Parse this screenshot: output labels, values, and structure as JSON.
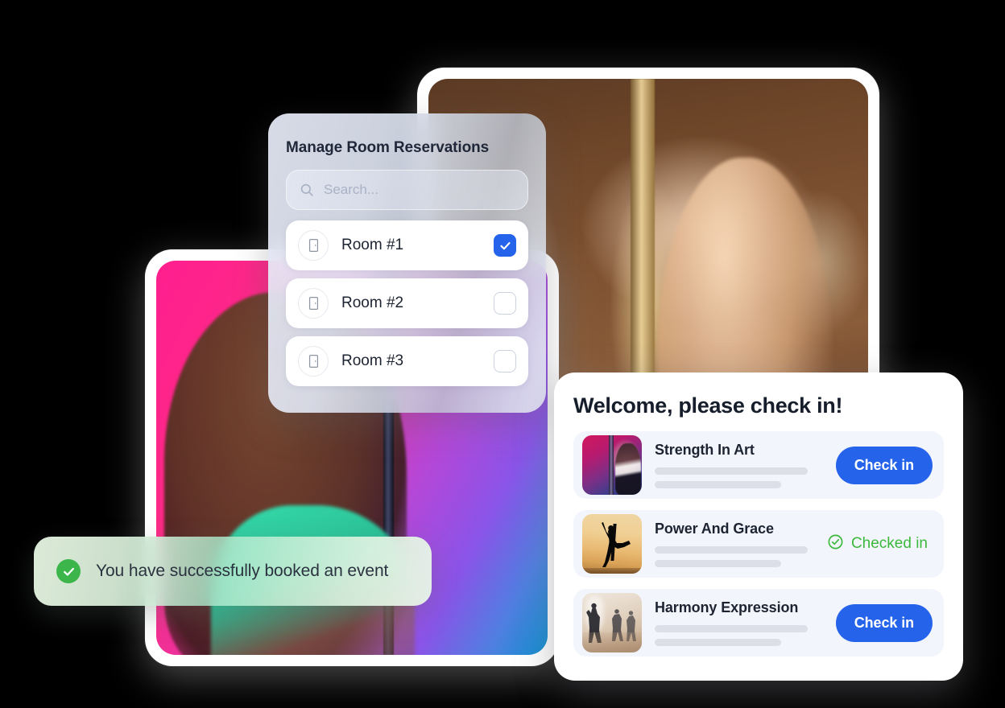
{
  "rooms_modal": {
    "title": "Manage Room Reservations",
    "search": {
      "placeholder": "Search...",
      "value": "",
      "icon": "search-icon"
    },
    "rows": [
      {
        "label": "Room #1",
        "icon": "door-icon",
        "checked": true
      },
      {
        "label": "Room #2",
        "icon": "door-icon",
        "checked": false
      },
      {
        "label": "Room #3",
        "icon": "door-icon",
        "checked": false
      }
    ]
  },
  "checkin_panel": {
    "title": "Welcome, please check in!",
    "events": [
      {
        "name": "Strength In Art",
        "thumb": "pole-dance-photo",
        "action_type": "button",
        "action_label": "Check in"
      },
      {
        "name": "Power And Grace",
        "thumb": "ballet-silhouette-photo",
        "action_type": "status",
        "action_label": "Checked in",
        "status_icon": "check-circle-icon"
      },
      {
        "name": "Harmony Expression",
        "thumb": "dance-studio-photo",
        "action_type": "button",
        "action_label": "Check in"
      }
    ]
  },
  "toast": {
    "message": "You have successfully booked an event",
    "icon": "success-check-icon"
  },
  "photos": [
    {
      "name": "studio-pole-portrait-photo"
    },
    {
      "name": "neon-gradient-portrait-photo"
    }
  ],
  "colors": {
    "primary_blue": "#2563eb",
    "success_green": "#3cb83c",
    "toast_green": "#3cb54a",
    "text_dark": "#1d2431",
    "skeleton_gray": "#dcdfe8",
    "panel_bg": "#f3f5fd"
  }
}
